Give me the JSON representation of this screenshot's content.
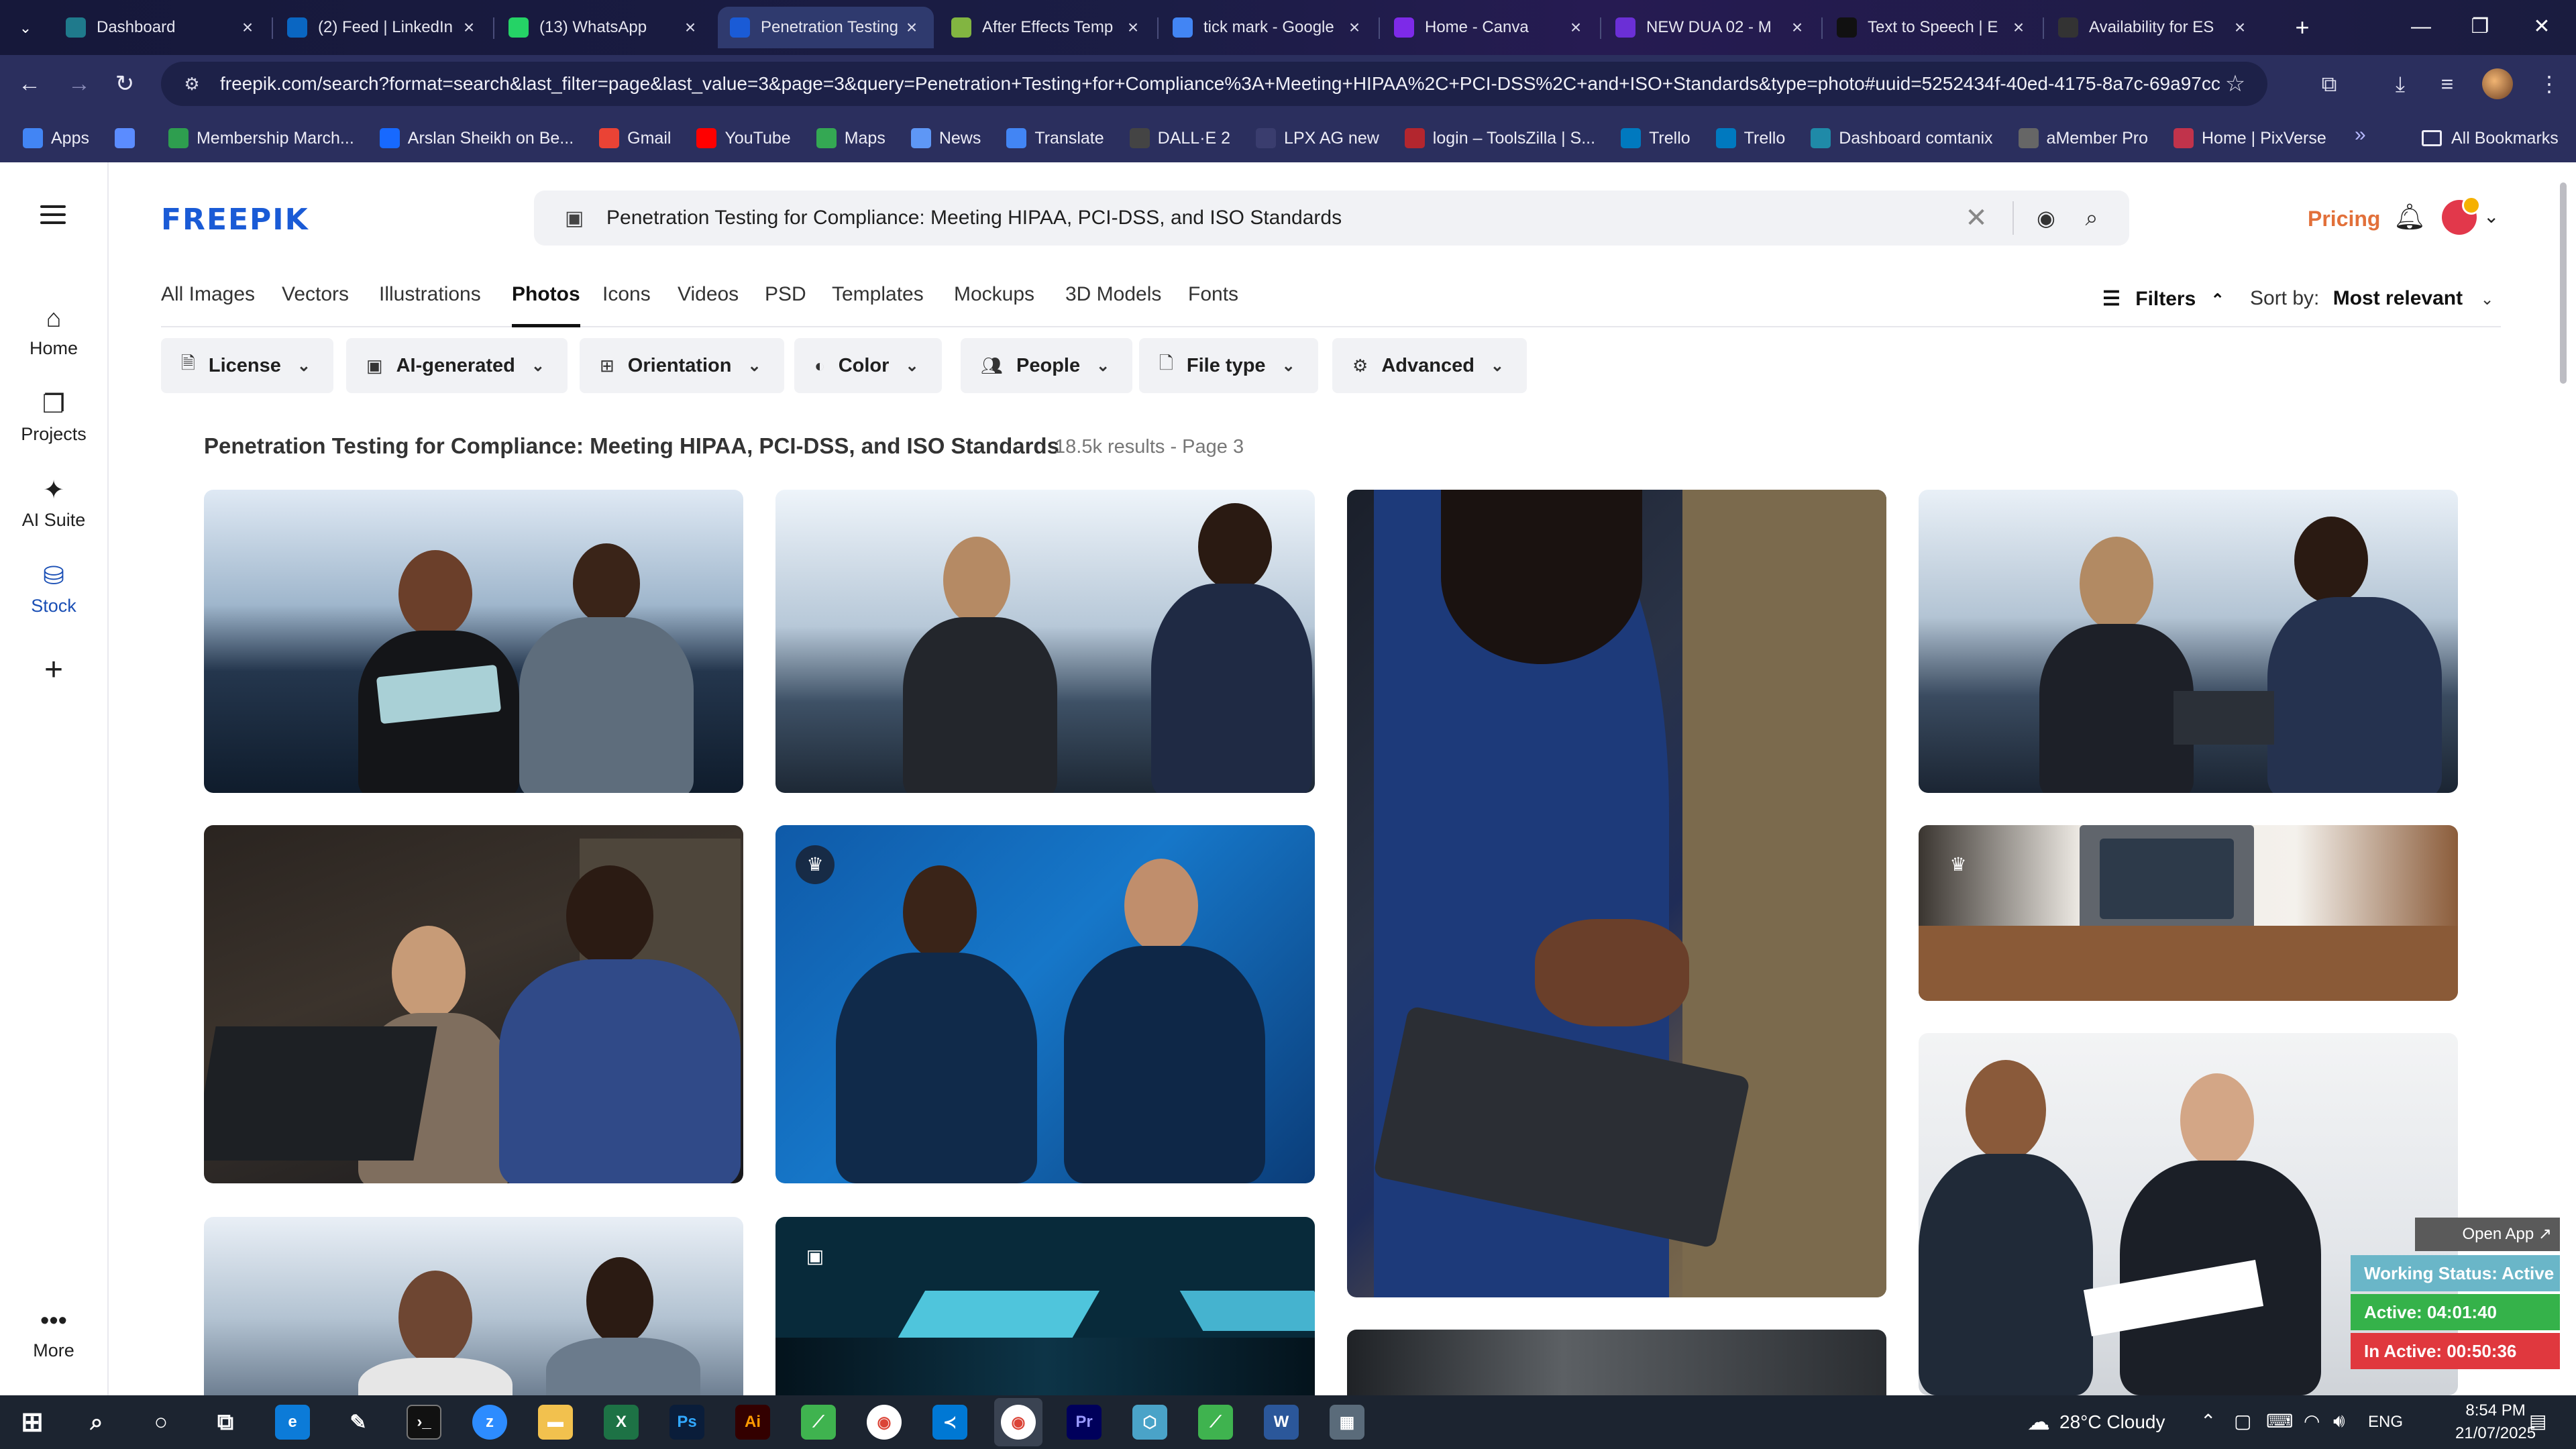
{
  "browser": {
    "tabs": [
      {
        "title": "Dashboard",
        "icon": "dashboard-favicon",
        "color": "#1f7a8c"
      },
      {
        "title": "(2) Feed | LinkedIn",
        "icon": "linkedin-favicon",
        "color": "#0a66c2"
      },
      {
        "title": "(13) WhatsApp",
        "icon": "whatsapp-favicon",
        "color": "#25d366"
      },
      {
        "title": "Penetration Testing",
        "icon": "freepik-favicon",
        "color": "#1a5bd6"
      },
      {
        "title": "After Effects Temp",
        "icon": "envato-favicon",
        "color": "#82b541"
      },
      {
        "title": "tick mark - Google",
        "icon": "google-favicon",
        "color": "#4285f4"
      },
      {
        "title": "Home - Canva",
        "icon": "canva-favicon",
        "color": "#7d2ae8"
      },
      {
        "title": "NEW DUA 02 - M",
        "icon": "video-favicon",
        "color": "#6b2fd6"
      },
      {
        "title": "Text to Speech | E",
        "icon": "elevenlabs-favicon",
        "color": "#111111"
      },
      {
        "title": "Availability for ES",
        "icon": "github-favicon",
        "color": "#333333"
      }
    ],
    "url": "freepik.com/search?format=search&last_filter=page&last_value=3&page=3&query=Penetration+Testing+for+Compliance%3A+Meeting+HIPAA%2C+PCI-DSS%2C+and+ISO+Standards&type=photo#uuid=5252434f-40ed-4175-8a7c-69a97cc...",
    "bookmarks": [
      {
        "label": "Apps",
        "icon": "apps-grid-icon",
        "color": "#4285f4"
      },
      {
        "label": "",
        "icon": "grid-icon",
        "color": "#5b8cff"
      },
      {
        "label": "Membership March...",
        "icon": "membership-favicon",
        "color": "#2e9e4f"
      },
      {
        "label": "Arslan Sheikh on Be...",
        "icon": "behance-favicon",
        "color": "#1769ff"
      },
      {
        "label": "Gmail",
        "icon": "gmail-favicon",
        "color": "#ea4335"
      },
      {
        "label": "YouTube",
        "icon": "youtube-favicon",
        "color": "#ff0000"
      },
      {
        "label": "Maps",
        "icon": "maps-favicon",
        "color": "#34a853"
      },
      {
        "label": "News",
        "icon": "news-favicon",
        "color": "#5e97f6"
      },
      {
        "label": "Translate",
        "icon": "translate-favicon",
        "color": "#4285f4"
      },
      {
        "label": "DALL·E 2",
        "icon": "openai-favicon",
        "color": "#444444"
      },
      {
        "label": "LPX AG new",
        "icon": "globe-favicon",
        "color": "#3a3d6e"
      },
      {
        "label": "login – ToolsZilla | S...",
        "icon": "toolszilla-favicon",
        "color": "#b3262e"
      },
      {
        "label": "Trello",
        "icon": "trello-favicon",
        "color": "#0079bf"
      },
      {
        "label": "Trello",
        "icon": "trello-favicon",
        "color": "#0079bf"
      },
      {
        "label": "Dashboard comtanix",
        "icon": "comtanix-favicon",
        "color": "#1f8aa8"
      },
      {
        "label": "aMember Pro",
        "icon": "amember-favicon",
        "color": "#666666"
      },
      {
        "label": "Home | PixVerse",
        "icon": "pixverse-favicon",
        "color": "#c1334b"
      }
    ],
    "all_bookmarks": "All Bookmarks"
  },
  "header": {
    "logo": "FREEPIK",
    "search_query": "Penetration Testing for Compliance: Meeting HIPAA, PCI-DSS, and ISO Standards",
    "pricing": "Pricing"
  },
  "sidebar": [
    {
      "label": "Home",
      "icon": "home-icon"
    },
    {
      "label": "Projects",
      "icon": "projects-icon"
    },
    {
      "label": "AI Suite",
      "icon": "ai-sparkle-icon"
    },
    {
      "label": "Stock",
      "icon": "stock-icon"
    },
    {
      "label": "",
      "icon": "plus-icon"
    },
    {
      "label": "More",
      "icon": "more-dots-icon"
    }
  ],
  "categories": [
    "All Images",
    "Vectors",
    "Illustrations",
    "Photos",
    "Icons",
    "Videos",
    "PSD",
    "Templates",
    "Mockups",
    "3D Models",
    "Fonts"
  ],
  "active_category": "Photos",
  "filters_label": "Filters",
  "sort": {
    "label": "Sort by:",
    "value": "Most relevant"
  },
  "filter_chips": [
    {
      "label": "License",
      "icon": "license-icon"
    },
    {
      "label": "AI-generated",
      "icon": "ai-icon"
    },
    {
      "label": "Orientation",
      "icon": "orientation-icon"
    },
    {
      "label": "Color",
      "icon": "palette-icon"
    },
    {
      "label": "People",
      "icon": "people-icon"
    },
    {
      "label": "File type",
      "icon": "file-icon"
    },
    {
      "label": "Advanced",
      "icon": "settings-icon"
    }
  ],
  "results": {
    "title": "Penetration Testing for Compliance: Meeting HIPAA, PCI-DSS, and ISO Standards",
    "meta": "18.5k results - Page 3"
  },
  "tracker": {
    "open_app": "Open App ↗",
    "working": "Working Status: Active",
    "active": "Active: 04:01:40",
    "inactive": "In Active: 00:50:36"
  },
  "taskbar": {
    "weather": "28°C  Cloudy",
    "language": "ENG",
    "time": "8:54 PM",
    "date": "21/07/2025"
  }
}
